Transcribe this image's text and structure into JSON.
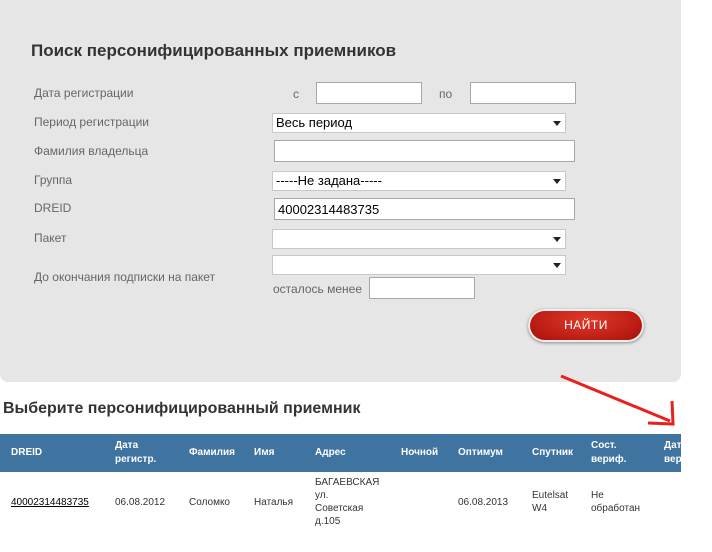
{
  "search": {
    "title": "Поиск персонифицированных приемников",
    "labels": {
      "reg_date": "Дата регистрации",
      "reg_period": "Период регистрации",
      "owner_surname": "Фамилия владельца",
      "group": "Группа",
      "dreid": "DREID",
      "package": "Пакет",
      "until_end": "До окончания подписки на пакет"
    },
    "from_label": "с",
    "to_label": "по",
    "from_value": "",
    "to_value": "",
    "period_value": "Весь период",
    "surname_value": "",
    "group_value": "-----Не задана-----",
    "dreid_value": "40002314483735",
    "package_value": "",
    "until_value": "",
    "remaining_label": "осталось менее",
    "remaining_value": "",
    "find_button": "НАЙТИ"
  },
  "results": {
    "title": "Выберите персонифицированный приемник",
    "headers": {
      "dreid": "DREID",
      "reg_date_1": "Дата",
      "reg_date_2": "регистр.",
      "surname": "Фамилия",
      "name": "Имя",
      "address": "Адрес",
      "night": "Ночной",
      "optimum": "Оптимум",
      "satellite": "Спутник",
      "verif_1": "Сост.",
      "verif_2": "вериф.",
      "verif_date_1": "Дат",
      "verif_date_2": "вер"
    },
    "row": {
      "dreid": "40002314483735",
      "reg_date": "06.08.2012",
      "surname": "Соломко",
      "name": "Наталья",
      "address_1": "БАГАЕВСКАЯ",
      "address_2": "ул.",
      "address_3": "Советская",
      "address_4": "д.105",
      "night": "",
      "optimum": "06.08.2013",
      "satellite_1": "Eutelsat",
      "satellite_2": "W4",
      "verif_1": "Не",
      "verif_2": "обработан"
    }
  },
  "annotation": {
    "arrow_color": "#e8211c"
  }
}
